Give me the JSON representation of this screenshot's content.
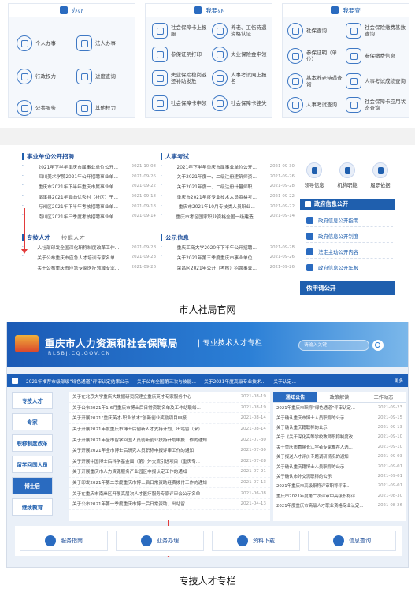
{
  "top": {
    "boxes": [
      {
        "title": "办办",
        "items": [
          "个人办事",
          "法人办事",
          "行政权力",
          "进度查询",
          "公共服务",
          "其他权力"
        ]
      },
      {
        "title": "我要办",
        "items": [
          "社会保障卡上报服",
          "养老、工伤待遇资格认证",
          "参保证明打印",
          "失业保险金申领",
          "失业保险稳岗返还补助发放",
          "人事考试网上报名",
          "社会保障卡申领",
          "社会保障卡挂失"
        ]
      },
      {
        "title": "我要查",
        "items": [
          "社保查询",
          "社会保险缴费基数查询",
          "参保证明（单位）",
          "参保缴费信息",
          "基本养老待遇查询",
          "人事考试成绩查询",
          "人事考试查询",
          "社会保障卡应用状态查询"
        ]
      }
    ],
    "news": {
      "col1_title": "事业单位公开招聘",
      "col1": [
        {
          "t": "2021年下半年重庆市属事业单位公开...",
          "d": "2021-10-08"
        },
        {
          "t": "四川美术学院2021年公开招聘事业单...",
          "d": "2021-09-26"
        },
        {
          "t": "重庆市2021年下半年重庆市属事业单...",
          "d": "2021-09-22"
        },
        {
          "t": "巫溪县2021年面向优秀村（社区）干...",
          "d": "2021-09-18"
        },
        {
          "t": "万州区2021年下半年考核招聘事业单...",
          "d": "2021-09-18"
        },
        {
          "t": "南川区2021年三季度考核招聘事业单...",
          "d": "2021-09-14"
        }
      ],
      "col1b_title": "专技人才",
      "col1b_alt": "技能人才",
      "col1b": [
        {
          "t": "人社部印发全国深化职称制度改革工作...",
          "d": "2021-09-28"
        },
        {
          "t": "关于公布重庆市应急人才培训专家名单...",
          "d": "2021-09-23"
        },
        {
          "t": "关于公布重庆市应急专家医疗领域专业...",
          "d": "2021-09-26"
        }
      ],
      "col2_title": "人事考试",
      "col2": [
        {
          "t": "2021年下半年重庆市属事业单位公开...",
          "d": "2021-09-30"
        },
        {
          "t": "关于2021年度一、二级注册建筑师资...",
          "d": "2021-09-26"
        },
        {
          "t": "关于2021年度一、二级注册计量师职...",
          "d": "2021-09-28"
        },
        {
          "t": "重庆市2021年度专业技术人员资格考...",
          "d": "2021-09-22"
        },
        {
          "t": "重庆市2021年10月专技类人员职业...",
          "d": "2021-09-22"
        },
        {
          "t": "重庆市考区国家职业资格全国一级建造...",
          "d": "2021-09-14"
        }
      ],
      "col2b_title": "公示信息",
      "col2b": [
        {
          "t": "重庆工商大学2020年下半年公开招聘...",
          "d": "2021-09-28"
        },
        {
          "t": "关于2021年第三季度重庆市事业单位...",
          "d": "2021-09-26"
        },
        {
          "t": "荣昌区2021年公开（考核）招聘事业...",
          "d": "2021-09-26"
        }
      ]
    },
    "side": {
      "quick": [
        "领导信息",
        "机构职能",
        "履职依据"
      ],
      "gov_title": "政府信息公开",
      "gov_items": [
        "政府信息公开指南",
        "政府信息公开制度",
        "法定主动公开内容",
        "政府信息公开年报"
      ],
      "apply": "依申请公开"
    },
    "caption": "市人社局官网"
  },
  "bottom": {
    "banner_title": "重庆市人力资源和社会保障局",
    "banner_sub": "| 专业技术人才专栏",
    "banner_url": "RLSBJ.CQ.GOV.CN",
    "search_placeholder": "请输入关键",
    "ticker": [
      "2021年推荐市级部级“绿色通道”评审认定结果公示",
      "关于公布全国第三次与技能...",
      "关于2021年度高级专业技术...",
      "关于认定..."
    ],
    "ticker_more": "更多",
    "left_menu": [
      "专技人才",
      "专家",
      "职称制度改革",
      "留学回国人员",
      "博士后",
      "继续教育"
    ],
    "left_active": 4,
    "mid_rows": [
      {
        "t": "关于在北京大学重庆大数据研究院建立重庆英才专家服务中心",
        "d": "2021-08-19"
      },
      {
        "t": "关于公布2021年1-6月重庆市博士后日常资助名单及工作站联络...",
        "d": "2021-08-19"
      },
      {
        "t": "关于开展2021“重庆英才·职业技术”创新创业奖励项目申报",
        "d": "2021-08-14"
      },
      {
        "t": "关于开展2021年度重庆市博士后创新人才支持计划、出站留（来）...",
        "d": "2021-08-14"
      },
      {
        "t": "关于开展2021年全市留学回国人员创新创业扶持计划申报工作的通知",
        "d": "2021-07-30"
      },
      {
        "t": "关于开展2021年全市博士后研究人员职称申报评审工作的通知",
        "d": "2021-07-30"
      },
      {
        "t": "关于开展中国博士后科学基金面（第）外交流引进项目（重庆专...",
        "d": "2021-07-28"
      },
      {
        "t": "关于开展重庆市人力资源服务产业园区申报认定工作的通知",
        "d": "2021-07-21"
      },
      {
        "t": "关于印发2021年第二季度重庆市博士后日常资助经费拨付工作的通知",
        "d": "2021-07-13"
      },
      {
        "t": "关于在重庆市南岸区开展高层次人才医疗服务专家评审会公示名单",
        "d": "2021-06-08"
      },
      {
        "t": "关于公布2021年第一季度重庆市博士后日常资助、出站留...",
        "d": "2021-04-13"
      }
    ],
    "right_tabs": [
      "通知公告",
      "政策解读",
      "工作动态"
    ],
    "right_rows": [
      {
        "t": "2021年重庆市职称“绿色通道”评审认定...",
        "d": "2021-09-23"
      },
      {
        "t": "关于确认重庆市博士人员职称的公示",
        "d": "2021-09-15"
      },
      {
        "t": "关于确认重庆籍职称的公示",
        "d": "2021-09-13"
      },
      {
        "t": "关于《关于深化高等学校教师职称制度改...",
        "d": "2021-09-10"
      },
      {
        "t": "关于重庆市首届长江学者专家推荐人选...",
        "d": "2021-09-10"
      },
      {
        "t": "关于报送人才评价专题调研情况的通知",
        "d": "2021-09-03"
      },
      {
        "t": "关于确认重庆籍博士人员职称的公示",
        "d": "2021-09-01"
      },
      {
        "t": "关于确认市外交流职称的公示",
        "d": "2021-09-01"
      },
      {
        "t": "2021年重庆市高级职称评审职称评审...",
        "d": "2021-09-01"
      },
      {
        "t": "重庆市2021年度第二次评审中高级职称评...",
        "d": "2021-08-30"
      },
      {
        "t": "2021年度重庆市高级人才职业资格专业认定...",
        "d": "2021-08-26"
      }
    ],
    "bottom_bar": [
      "服务指南",
      "业务办理",
      "资料下载",
      "信息查询"
    ],
    "caption": "专技人才专栏"
  },
  "colors": {
    "primary": "#1f5fae",
    "arrow": "#e23b3b",
    "banner": "#1b5ab5"
  }
}
